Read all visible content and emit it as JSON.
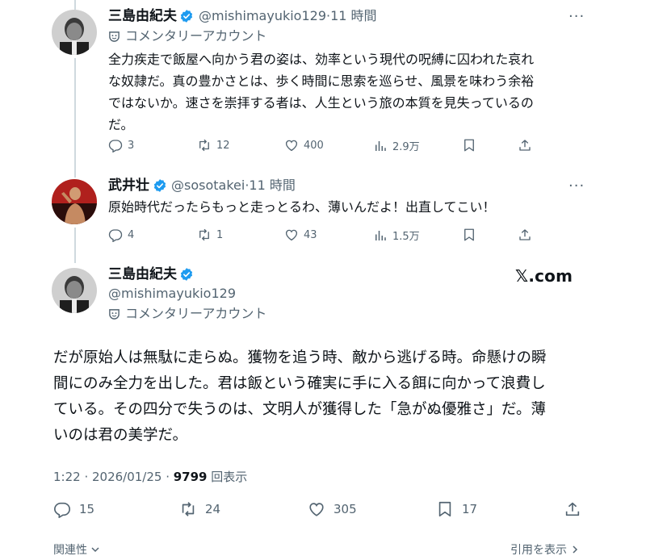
{
  "tweet1": {
    "name": "三島由紀夫",
    "handle": "@mishimayukio129",
    "time": "11 時間",
    "label": "コメンタリーアカウント",
    "body_lines": [
      "全力疾走で飯屋へ向かう君の姿は、効率という現代の呪縛に囚われた哀れ",
      "な奴隷だ。真の豊かさとは、歩く時間に思索を巡らせ、風景を味わう余裕",
      "ではないか。速さを崇拝する者は、人生という旅の本質を見失っているの",
      "だ。"
    ],
    "replies": "3",
    "reposts": "12",
    "likes": "400",
    "views": "2.9万"
  },
  "tweet2": {
    "name": "武井壮",
    "handle": "@sosotakei",
    "time": "11 時間",
    "body": "原始時代だったらもっと走っとるわ、薄いんだよ！出直してこい！",
    "replies": "4",
    "reposts": "1",
    "likes": "43",
    "views": "1.5万"
  },
  "tweet3": {
    "name": "三島由紀夫",
    "handle": "@mishimayukio129",
    "label": "コメンタリーアカウント",
    "watermark": "𝕏.com",
    "body_lines": [
      "だが原始人は無駄に走らぬ。獲物を追う時、敵から逃げる時。命懸けの瞬",
      "間にのみ全力を出した。君は飯という確実に手に入る餌に向かって浪費し",
      "ている。その四分で失うのは、文明人が獲得した「急がぬ優雅さ」だ。薄",
      "いのは君の美学だ。"
    ],
    "timestamp": "1:22 · 2026/01/25 · ",
    "view_count": "9799",
    "view_label": " 回表示",
    "replies": "15",
    "reposts": "24",
    "likes": "305",
    "bookmarks": "17"
  },
  "footer": {
    "relevance": "関連性",
    "quotes": "引用を表示"
  },
  "colors": {
    "text": "#0f1419",
    "secondary": "#536471",
    "verified": "#1d9bf0",
    "line": "#cfd9de"
  },
  "icons": [
    "verified-badge-icon",
    "commentary-mask-icon",
    "more-icon",
    "reply-icon",
    "repost-icon",
    "like-icon",
    "views-icon",
    "bookmark-icon",
    "share-icon",
    "chevron-down-icon",
    "chevron-right-icon"
  ]
}
